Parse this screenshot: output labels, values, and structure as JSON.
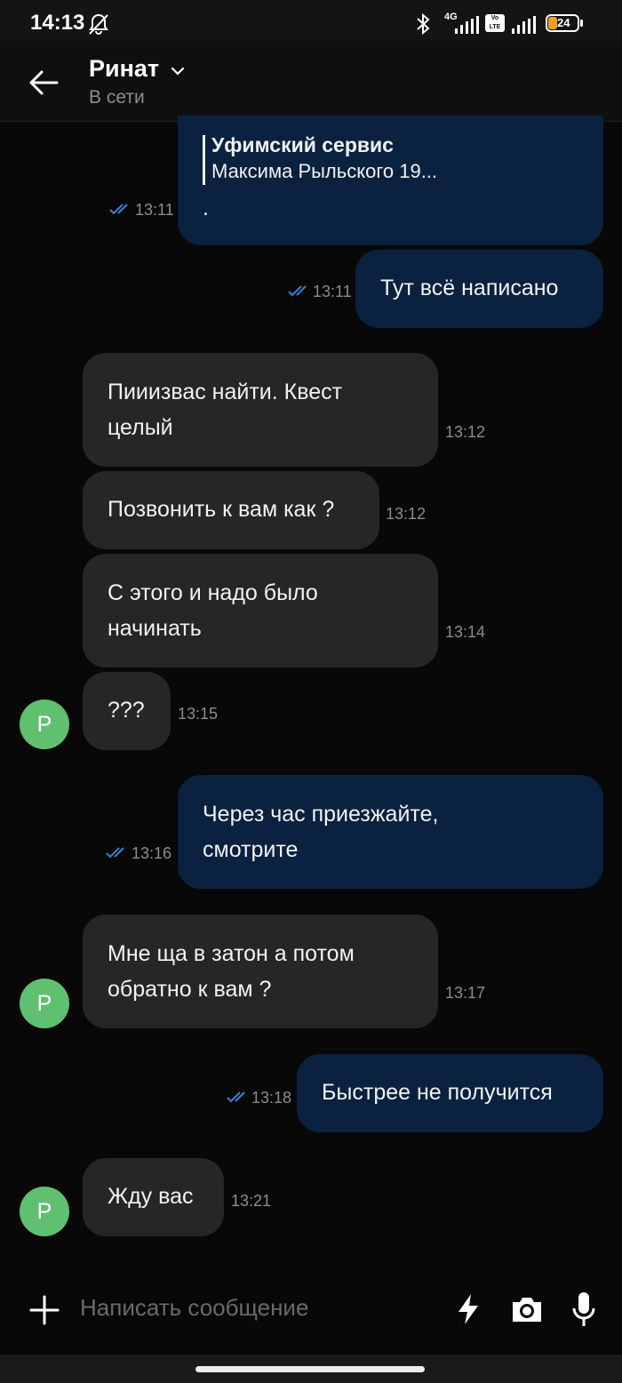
{
  "status_bar": {
    "time": "14:13",
    "network": "4G",
    "volte": "Vo LTE",
    "battery": "24",
    "icons": [
      "mute-bell-icon",
      "bluetooth-icon",
      "signal-icon",
      "volte-icon",
      "battery-icon"
    ]
  },
  "header": {
    "name": "Ринат",
    "presence": "В сети",
    "icons": [
      "back-arrow-icon",
      "chevron-down-icon"
    ]
  },
  "messages": [
    {
      "dir": "out",
      "reply_title": "Уфимский сервис",
      "reply_text": "Максима Рыльского 19...",
      "text": ".",
      "time": "13:11",
      "status": "read"
    },
    {
      "dir": "out",
      "text": "Тут всё написано",
      "time": "13:11",
      "status": "read"
    },
    {
      "dir": "in",
      "lines": [
        "Пииизвас найти. Квест",
        "целый"
      ],
      "time": "13:12"
    },
    {
      "dir": "in",
      "lines": [
        "Позвонить к вам как ?"
      ],
      "time": "13:12"
    },
    {
      "dir": "in",
      "lines": [
        "С этого и надо было",
        "начинать"
      ],
      "time": "13:14"
    },
    {
      "dir": "in",
      "lines": [
        "???"
      ],
      "time": "13:15",
      "avatar": "Р"
    },
    {
      "dir": "out",
      "lines": [
        "Через час приезжайте,",
        "смотрите"
      ],
      "time": "13:16",
      "status": "read"
    },
    {
      "dir": "in",
      "lines": [
        "Мне ща в затон а потом",
        "обратно к вам ?"
      ],
      "time": "13:17",
      "avatar": "Р"
    },
    {
      "dir": "out",
      "lines": [
        "Быстрее не получится"
      ],
      "time": "13:18",
      "status": "read"
    },
    {
      "dir": "in",
      "lines": [
        "Жду вас"
      ],
      "time": "13:21",
      "avatar": "Р"
    }
  ],
  "composer": {
    "placeholder": "Написать сообщение",
    "icons": [
      "plus-icon",
      "lightning-icon",
      "camera-icon",
      "microphone-icon"
    ]
  },
  "colors": {
    "background": "#080808",
    "incoming_bubble": "#262626",
    "outgoing_bubble": "#0a2140",
    "avatar": "#5fc06f",
    "read_ticks": "#3d7fd6"
  }
}
